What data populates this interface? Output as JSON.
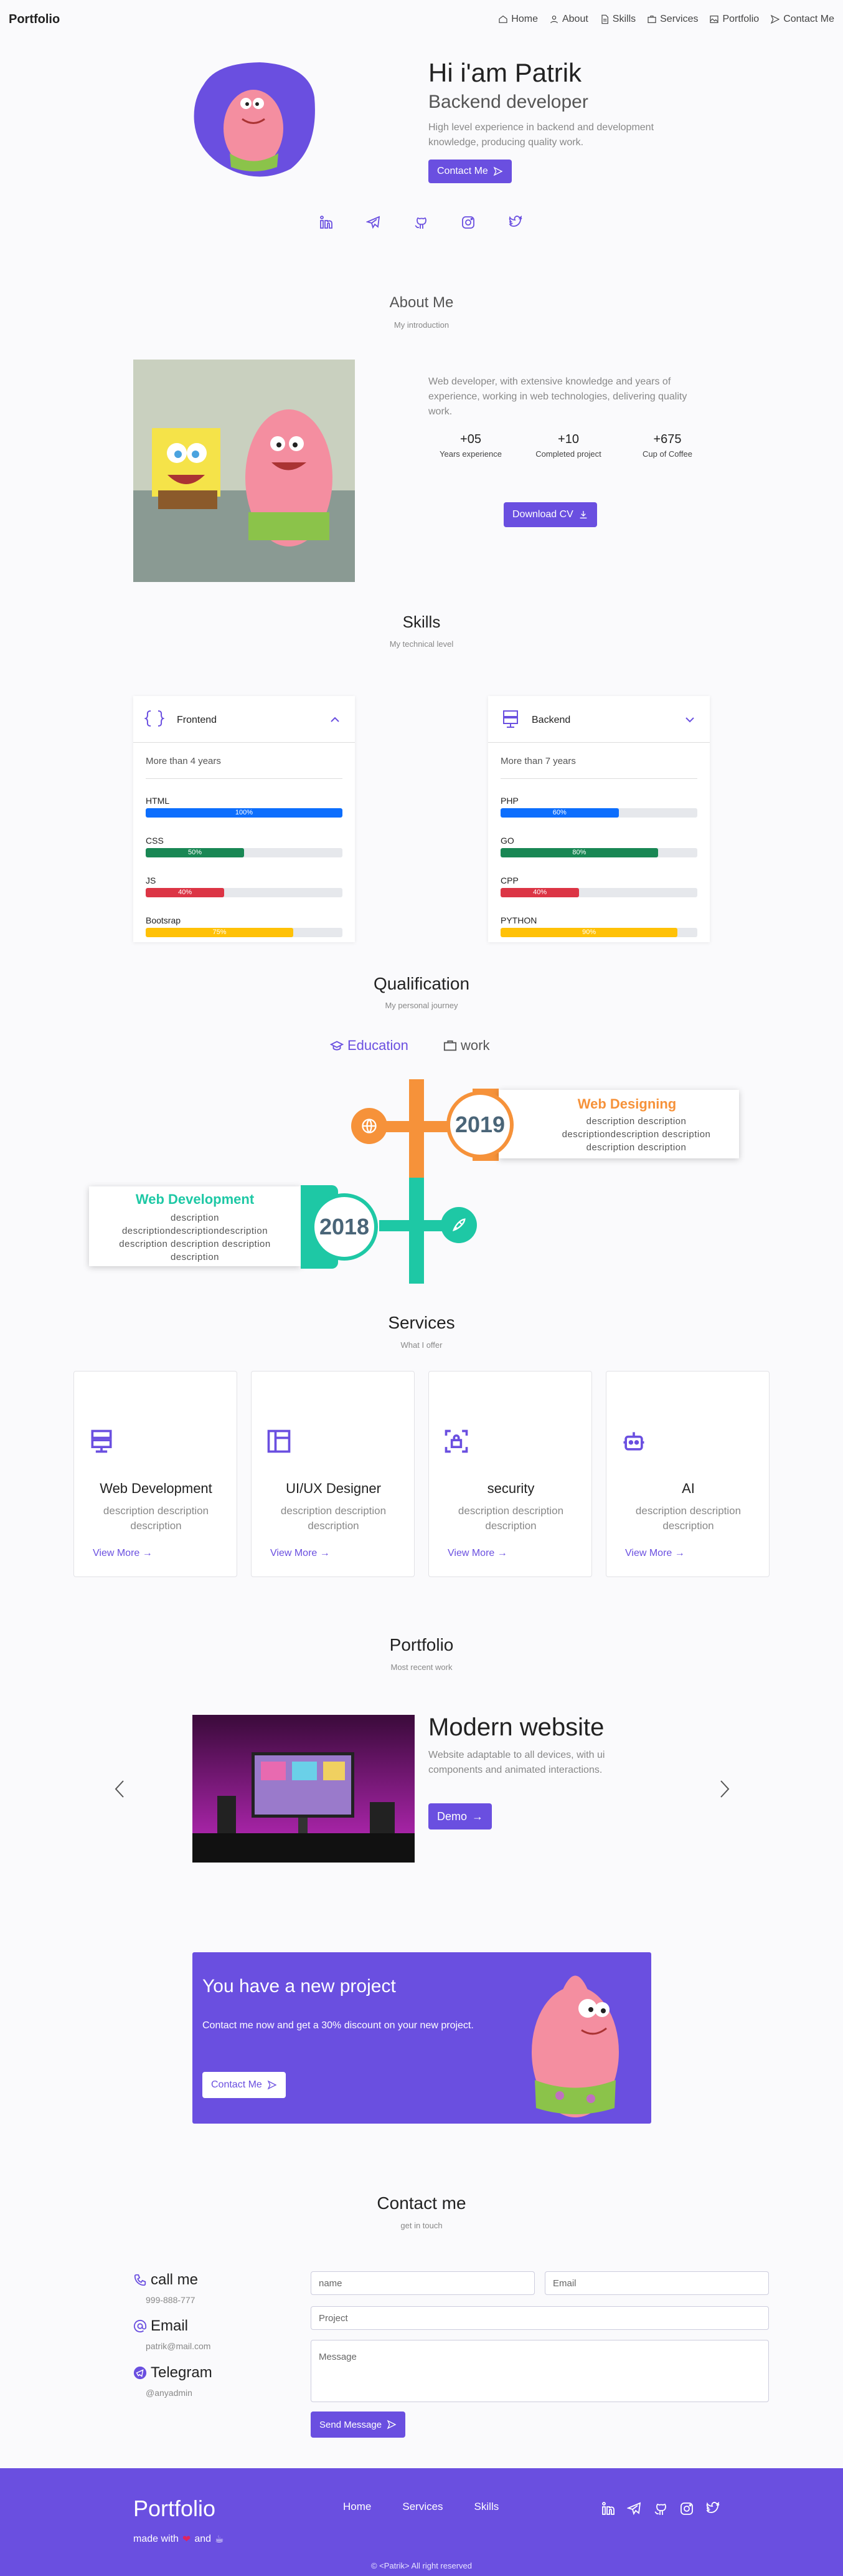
{
  "nav": {
    "brand": "Portfolio",
    "items": [
      {
        "label": "Home",
        "icon": "home-icon"
      },
      {
        "label": "About",
        "icon": "user-icon"
      },
      {
        "label": "Skills",
        "icon": "file-icon"
      },
      {
        "label": "Services",
        "icon": "briefcase-icon"
      },
      {
        "label": "Portfolio",
        "icon": "image-icon"
      },
      {
        "label": "Contact Me",
        "icon": "send-icon"
      }
    ]
  },
  "hero": {
    "title": "Hi i'am Patrik",
    "subtitle": "Backend developer",
    "description": "High level experience in backend and development knowledge, producing quality work.",
    "button": "Contact Me",
    "social": [
      "linkedin-icon",
      "telegram-icon",
      "github-icon",
      "instagram-icon",
      "twitter-icon"
    ]
  },
  "about": {
    "title": "About Me",
    "subtitle": "My introduction",
    "description": "Web developer, with extensive knowledge and years of experience, working in web technologies, delivering quality work.",
    "stats": [
      {
        "num": "+05",
        "label": "Years experience"
      },
      {
        "num": "+10",
        "label": "Completed project"
      },
      {
        "num": "+675",
        "label": "Cup of Coffee"
      }
    ],
    "button": "Download CV"
  },
  "skills": {
    "title": "Skills",
    "subtitle": "My technical level",
    "frontend": {
      "title": "Frontend",
      "experience": "More than 4 years",
      "items": [
        {
          "name": "HTML",
          "value": 100,
          "text": "100%",
          "color": "#0d6efd"
        },
        {
          "name": "CSS",
          "value": 50,
          "text": "50%",
          "color": "#198754"
        },
        {
          "name": "JS",
          "value": 40,
          "text": "40%",
          "color": "#dc3545"
        },
        {
          "name": "Bootsrap",
          "value": 75,
          "text": "75%",
          "color": "#ffc107"
        }
      ]
    },
    "backend": {
      "title": "Backend",
      "experience": "More than 7 years",
      "items": [
        {
          "name": "PHP",
          "value": 60,
          "text": "60%",
          "color": "#0d6efd"
        },
        {
          "name": "GO",
          "value": 80,
          "text": "80%",
          "color": "#198754"
        },
        {
          "name": "CPP",
          "value": 40,
          "text": "40%",
          "color": "#dc3545"
        },
        {
          "name": "PYTHON",
          "value": 90,
          "text": "90%",
          "color": "#ffc107"
        }
      ]
    }
  },
  "qualification": {
    "title": "Qualification",
    "subtitle": "My personal journey",
    "tabs": [
      "Education",
      "work"
    ],
    "items": [
      {
        "year": "2019",
        "title": "Web Designing",
        "desc": "description description descriptiondescription description description description",
        "color": "#f6923a"
      },
      {
        "year": "2018",
        "title": "Web Development",
        "desc": "description descriptiondescriptiondescription description description description description",
        "color": "#1ec8a5"
      }
    ]
  },
  "services": {
    "title": "Services",
    "subtitle": "What I offer",
    "items": [
      {
        "title": "Web Development",
        "desc": "description description description",
        "more": "View More"
      },
      {
        "title": "UI/UX Designer",
        "desc": "description description description",
        "more": "View More"
      },
      {
        "title": "security",
        "desc": "description description description",
        "more": "View More"
      },
      {
        "title": "AI",
        "desc": "description description description",
        "more": "View More"
      }
    ]
  },
  "portfolio": {
    "title": "Portfolio",
    "subtitle": "Most recent work",
    "item_title": "Modern website",
    "item_desc": "Website adaptable to all devices, with ui components and animated interactions.",
    "button": "Demo"
  },
  "project": {
    "title": "You have a new project",
    "desc": "Contact me now and get a 30% discount on your new project.",
    "button": "Contact Me"
  },
  "contact": {
    "title": "Contact me",
    "subtitle": "get in touch",
    "info": [
      {
        "title": "call me",
        "value": "999-888-777",
        "icon": "phone-icon"
      },
      {
        "title": "Email",
        "value": "patrik@mail.com",
        "icon": "at-icon"
      },
      {
        "title": "Telegram",
        "value": "@anyadmin",
        "icon": "telegram-icon"
      }
    ],
    "placeholders": {
      "name": "name",
      "email": "Email",
      "project": "Project",
      "message": "Message"
    },
    "button": "Send Message"
  },
  "footer": {
    "brand": "Portfolio",
    "made": "made with",
    "and": "and",
    "links": [
      "Home",
      "Services",
      "Skills"
    ],
    "copyright": "© <Patrik> All right reserved"
  },
  "colors": {
    "accent": "#6a4fe0",
    "orange": "#f6923a",
    "teal": "#1ec8a5"
  }
}
